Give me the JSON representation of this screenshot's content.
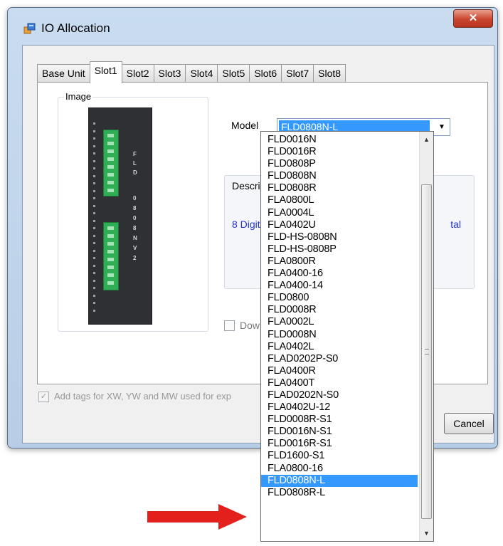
{
  "window": {
    "title": "IO Allocation",
    "close_label": "✕"
  },
  "tabs": [
    {
      "label": "Base Unit",
      "active": false
    },
    {
      "label": "Slot1",
      "active": true
    },
    {
      "label": "Slot2",
      "active": false
    },
    {
      "label": "Slot3",
      "active": false
    },
    {
      "label": "Slot4",
      "active": false
    },
    {
      "label": "Slot5",
      "active": false
    },
    {
      "label": "Slot6",
      "active": false
    },
    {
      "label": "Slot7",
      "active": false
    },
    {
      "label": "Slot8",
      "active": false
    }
  ],
  "image_group": {
    "label": "Image",
    "module_text_top": "FLD",
    "module_text_bottom": "0808N V2"
  },
  "model": {
    "label": "Model",
    "selected": "FLD0808N-L"
  },
  "description": {
    "label": "Descript",
    "text": "8 Digita",
    "tail": "tal"
  },
  "download": {
    "label": "Downl"
  },
  "add_tags": {
    "label": "Add tags for XW, YW and MW used for exp"
  },
  "cancel_button": "Cancel",
  "dropdown": {
    "items": [
      "FLD0016N",
      "FLD0016R",
      "FLD0808P",
      "FLD0808N",
      "FLD0808R",
      "FLA0800L",
      "FLA0004L",
      "FLA0402U",
      "FLD-HS-0808N",
      "FLD-HS-0808P",
      "FLA0800R",
      "FLA0400-16",
      "FLA0400-14",
      "FLD0800",
      "FLD0008R",
      "FLA0002L",
      "FLD0008N",
      "FLA0402L",
      "FLAD0202P-S0",
      "FLA0400R",
      "FLA0400T",
      "FLAD0202N-S0",
      "FLA0402U-12",
      "FLD0008R-S1",
      "FLD0016N-S1",
      "FLD0016R-S1",
      "FLD1600-S1",
      "FLA0800-16",
      "FLD0808N-L",
      "FLD0808R-L"
    ],
    "selected_index": 28
  },
  "colors": {
    "selection": "#3399ff",
    "arrow": "#e3201b",
    "module_terminal": "#2fae56"
  }
}
